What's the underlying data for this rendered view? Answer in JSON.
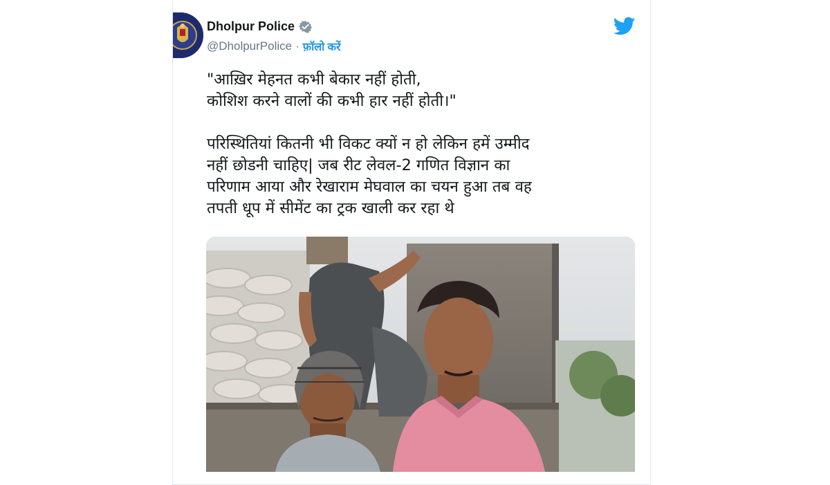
{
  "author": {
    "name": "Dholpur Police",
    "handle": "@DholpurPolice",
    "separator": "·",
    "follow_label": "फ़ॉलो करें",
    "verified": true
  },
  "icons": {
    "avatar": "rajasthan-police-emblem",
    "verified": "verified-badge-icon",
    "brand": "twitter-bird-icon"
  },
  "colors": {
    "brand_blue": "#1da1f2",
    "follow_blue": "#1b95e0",
    "text": "#14171a",
    "secondary_text": "#657786"
  },
  "tweet": {
    "lines_quote": [
      "\"आख़िर मेहनत कभी बेकार नहीं होती,",
      "कोशिश करने वालों की कभी हार नहीं होती।\""
    ],
    "lines_body": [
      "परिस्थितियां कितनी भी विकट क्यों न हो लेकिन हमें उम्मीद",
      "नहीं छोडनी चाहिए| जब रीट लेवल-2 गणित विज्ञान का",
      "परिणाम आया और रेखाराम मेघवाल का चयन हुआ तब वह",
      "तपती धूप में सीमेंट का ट्रक खाली कर रहा थे"
    ]
  },
  "media": {
    "kind": "photo"
  }
}
